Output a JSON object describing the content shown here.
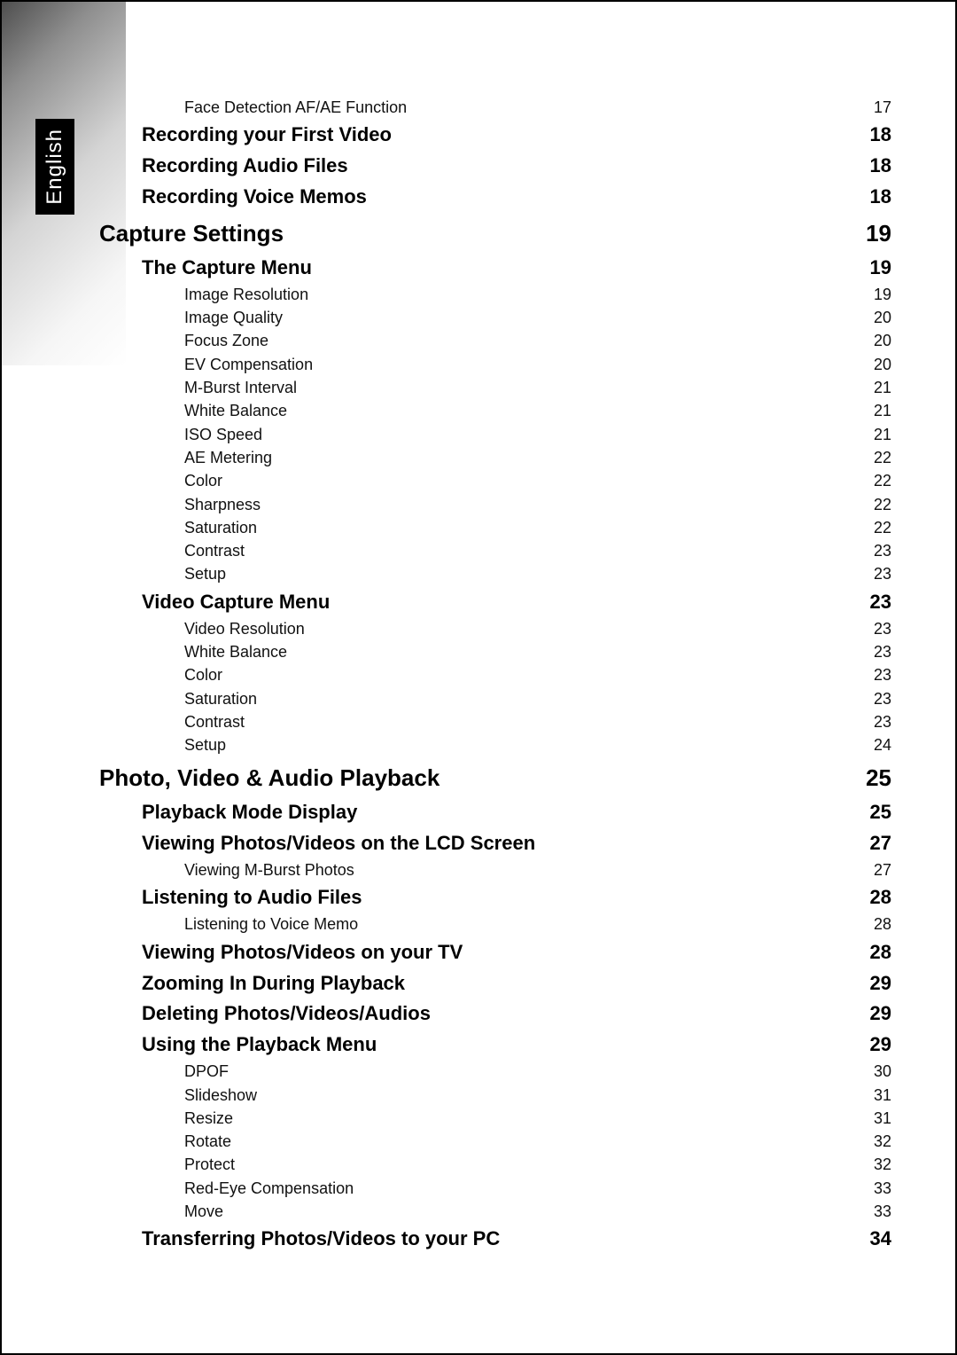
{
  "language_tab": "English",
  "toc": [
    {
      "level": 2,
      "title": "Face Detection AF/AE Function",
      "page": "17"
    },
    {
      "level": 1,
      "title": "Recording your First Video",
      "page": "18"
    },
    {
      "level": 1,
      "title": "Recording Audio Files",
      "page": "18"
    },
    {
      "level": 1,
      "title": "Recording Voice Memos",
      "page": "18"
    },
    {
      "level": 0,
      "title": "Capture Settings",
      "page": "19"
    },
    {
      "level": 1,
      "title": "The Capture Menu",
      "page": "19"
    },
    {
      "level": 2,
      "title": "Image Resolution",
      "page": "19"
    },
    {
      "level": 2,
      "title": "Image Quality",
      "page": "20"
    },
    {
      "level": 2,
      "title": "Focus Zone",
      "page": "20"
    },
    {
      "level": 2,
      "title": "EV Compensation",
      "page": "20"
    },
    {
      "level": 2,
      "title": "M-Burst Interval",
      "page": "21"
    },
    {
      "level": 2,
      "title": "White Balance",
      "page": "21"
    },
    {
      "level": 2,
      "title": "ISO Speed",
      "page": "21"
    },
    {
      "level": 2,
      "title": "AE Metering",
      "page": "22"
    },
    {
      "level": 2,
      "title": "Color",
      "page": "22"
    },
    {
      "level": 2,
      "title": "Sharpness",
      "page": "22"
    },
    {
      "level": 2,
      "title": "Saturation",
      "page": "22"
    },
    {
      "level": 2,
      "title": "Contrast",
      "page": "23"
    },
    {
      "level": 2,
      "title": "Setup",
      "page": "23"
    },
    {
      "level": 1,
      "title": "Video Capture Menu",
      "page": "23"
    },
    {
      "level": 2,
      "title": "Video Resolution",
      "page": "23"
    },
    {
      "level": 2,
      "title": "White Balance",
      "page": "23"
    },
    {
      "level": 2,
      "title": "Color",
      "page": "23"
    },
    {
      "level": 2,
      "title": "Saturation",
      "page": "23"
    },
    {
      "level": 2,
      "title": "Contrast",
      "page": "23"
    },
    {
      "level": 2,
      "title": "Setup",
      "page": "24"
    },
    {
      "level": 0,
      "title": "Photo, Video & Audio Playback",
      "page": "25"
    },
    {
      "level": 1,
      "title": "Playback Mode Display",
      "page": "25"
    },
    {
      "level": 1,
      "title": "Viewing Photos/Videos on the LCD Screen",
      "page": "27"
    },
    {
      "level": 2,
      "title": "Viewing M-Burst Photos",
      "page": "27"
    },
    {
      "level": 1,
      "title": "Listening to Audio Files",
      "page": "28"
    },
    {
      "level": 2,
      "title": "Listening to Voice Memo",
      "page": "28"
    },
    {
      "level": 1,
      "title": "Viewing Photos/Videos on your TV",
      "page": "28"
    },
    {
      "level": 1,
      "title": "Zooming In During Playback",
      "page": "29"
    },
    {
      "level": 1,
      "title": "Deleting Photos/Videos/Audios",
      "page": "29"
    },
    {
      "level": 1,
      "title": "Using the Playback Menu",
      "page": "29"
    },
    {
      "level": 2,
      "title": "DPOF",
      "page": "30"
    },
    {
      "level": 2,
      "title": "Slideshow",
      "page": "31"
    },
    {
      "level": 2,
      "title": "Resize",
      "page": "31"
    },
    {
      "level": 2,
      "title": "Rotate",
      "page": "32"
    },
    {
      "level": 2,
      "title": "Protect",
      "page": "32"
    },
    {
      "level": 2,
      "title": "Red-Eye Compensation",
      "page": "33"
    },
    {
      "level": 2,
      "title": "Move",
      "page": "33"
    },
    {
      "level": 1,
      "title": "Transferring Photos/Videos to your PC",
      "page": "34"
    }
  ]
}
